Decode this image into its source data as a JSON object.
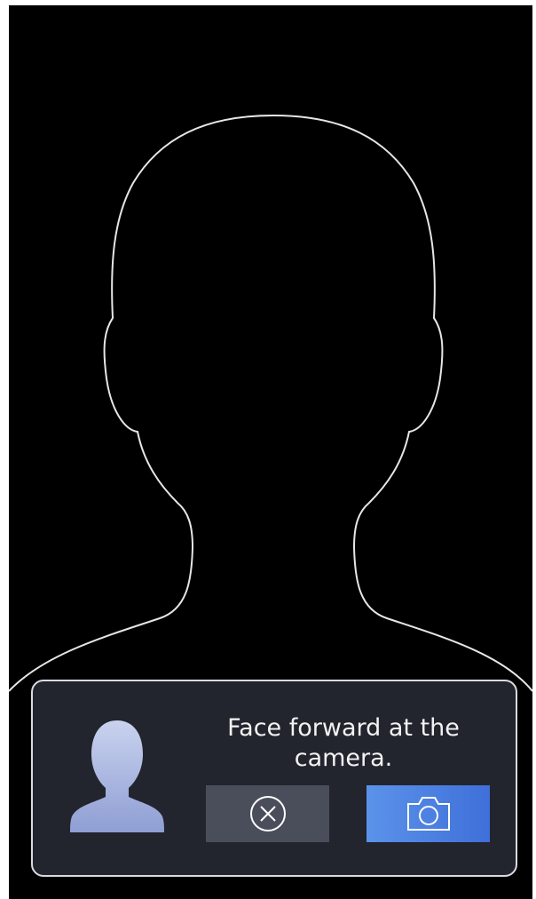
{
  "face_capture": {
    "prompt": "Face forward at the camera."
  },
  "buttons": {
    "cancel_icon": "close-circle-icon",
    "capture_icon": "camera-icon"
  },
  "colors": {
    "background": "#000000",
    "panel": "#22252d",
    "panel_border": "#d9dbe0",
    "cancel_button": "#4a4e5a",
    "capture_button": "#4a7fe0",
    "outline": "#e6e6e6"
  },
  "icons": {
    "guide": "head-shoulders-outline",
    "avatar": "user-avatar-icon"
  }
}
